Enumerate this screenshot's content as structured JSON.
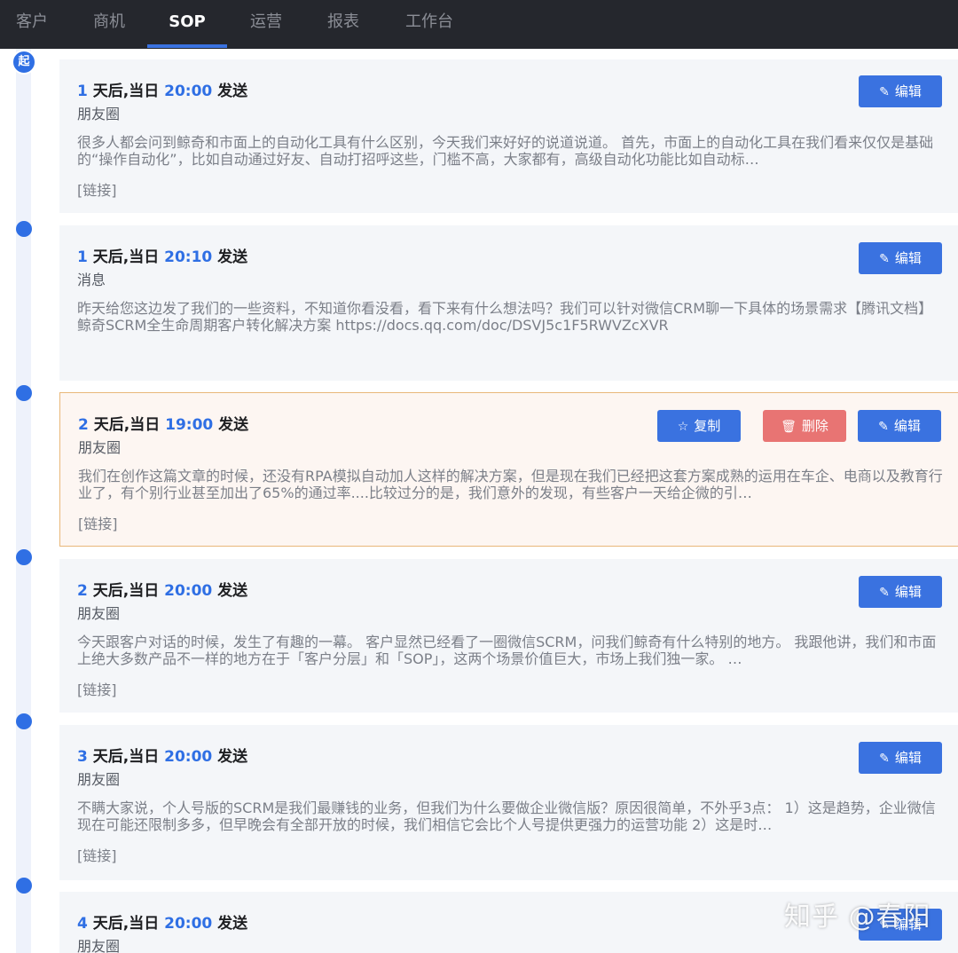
{
  "nav": {
    "tabs": [
      {
        "label": "客户"
      },
      {
        "label": "商机"
      },
      {
        "label": "SOP",
        "active": true
      },
      {
        "label": "运营"
      },
      {
        "label": "报表"
      },
      {
        "label": "工作台"
      }
    ]
  },
  "timeline": {
    "start_label": "起"
  },
  "buttons": {
    "edit": "编辑",
    "copy": "复制",
    "delete": "删除"
  },
  "cards": [
    {
      "day": "1",
      "day_suffix": " 天后,当日 ",
      "time": "20:00",
      "action": " 发送",
      "type": "朋友圈",
      "content": "很多人都会问到鲸奇和市面上的自动化工具有什么区别，今天我们来好好的说道说道。 首先，市面上的自动化工具在我们看来仅仅是基础的“操作自动化”，比如自动通过好友、自动打招呼这些，门槛不高，大家都有，高级自动化功能比如自动标…",
      "link": "[链接]"
    },
    {
      "day": "1",
      "day_suffix": " 天后,当日 ",
      "time": "20:10",
      "action": " 发送",
      "type": "消息",
      "content": "昨天给您这边发了我们的一些资料，不知道你看没看，看下来有什么想法吗？我们可以针对微信CRM聊一下具体的场景需求【腾讯文档】鲸奇SCRM全生命周期客户转化解决方案 https://docs.qq.com/doc/DSVJ5c1F5RWVZcXVR",
      "link": ""
    },
    {
      "day": "2",
      "day_suffix": " 天后,当日 ",
      "time": "19:00",
      "action": " 发送",
      "type": "朋友圈",
      "content": "我们在创作这篇文章的时候，还没有RPA模拟自动加人这样的解决方案，但是现在我们已经把这套方案成熟的运用在车企、电商以及教育行业了，有个别行业甚至加出了65%的通过率....比较过分的是，我们意外的发现，有些客户一天给企微的引…",
      "link": "[链接]"
    },
    {
      "day": "2",
      "day_suffix": " 天后,当日 ",
      "time": "20:00",
      "action": " 发送",
      "type": "朋友圈",
      "content": "今天跟客户对话的时候，发生了有趣的一幕。 客户显然已经看了一圈微信SCRM，问我们鲸奇有什么特别的地方。 我跟他讲，我们和市面上绝大多数产品不一样的地方在于「客户分层」和「SOP」，这两个场景价值巨大，市场上我们独一家。 …",
      "link": "[链接]"
    },
    {
      "day": "3",
      "day_suffix": " 天后,当日 ",
      "time": "20:00",
      "action": " 发送",
      "type": "朋友圈",
      "content": "不瞒大家说，个人号版的SCRM是我们最赚钱的业务，但我们为什么要做企业微信版？原因很简单，不外乎3点： 1）这是趋势，企业微信现在可能还限制多多，但早晚会有全部开放的时候，我们相信它会比个人号提供更强力的运营功能 2）这是时…",
      "link": "[链接]"
    },
    {
      "day": "4",
      "day_suffix": " 天后,当日 ",
      "time": "20:00",
      "action": " 发送",
      "type": "朋友圈",
      "content": "",
      "link": ""
    }
  ],
  "watermark": "知乎 @春阳"
}
